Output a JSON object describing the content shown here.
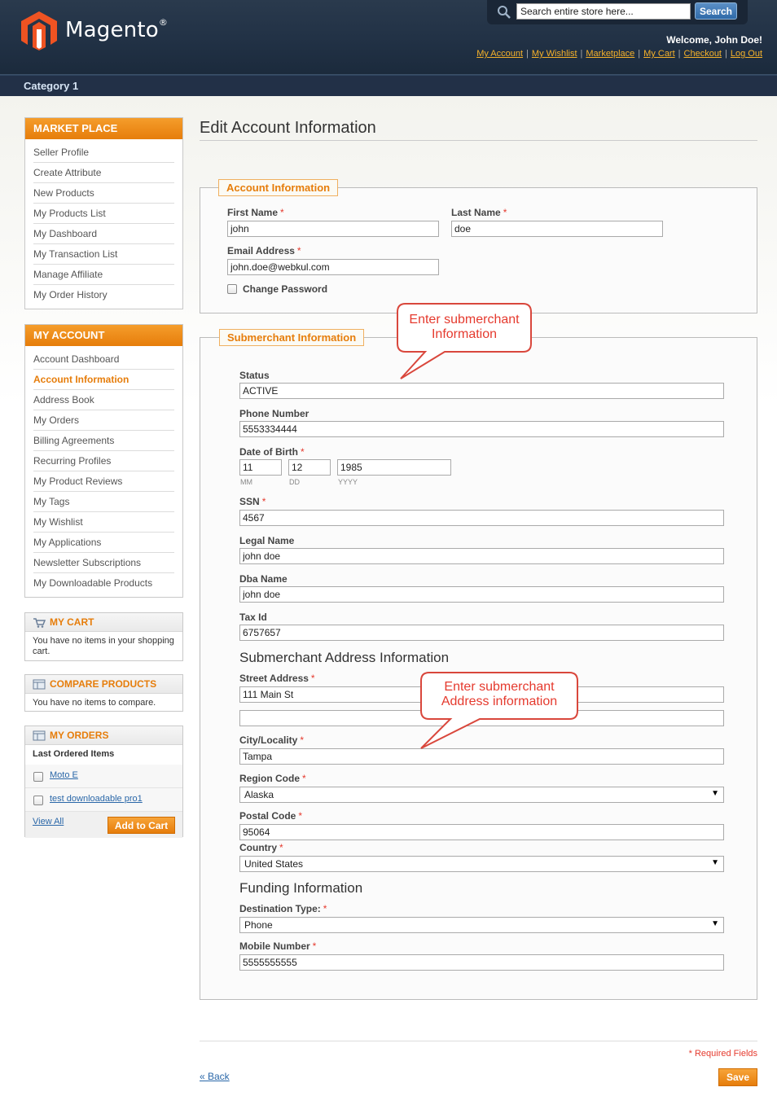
{
  "header": {
    "logo_text": "Magento",
    "logo_mark": "®",
    "search_placeholder": "Search entire store here...",
    "search_button": "Search",
    "welcome": "Welcome, John Doe!",
    "links": [
      "My Account",
      "My Wishlist",
      "Marketplace",
      "My Cart",
      "Checkout",
      "Log Out"
    ]
  },
  "nav": {
    "category": "Category 1"
  },
  "sidebar": {
    "marketplace": {
      "title": "MARKET PLACE",
      "items": [
        "Seller Profile",
        "Create Attribute",
        "New Products",
        "My Products List",
        "My Dashboard",
        "My Transaction List",
        "Manage Affiliate",
        "My Order History"
      ]
    },
    "my_account": {
      "title": "MY ACCOUNT",
      "active_index": 1,
      "items": [
        "Account Dashboard",
        "Account Information",
        "Address Book",
        "My Orders",
        "Billing Agreements",
        "Recurring Profiles",
        "My Product Reviews",
        "My Tags",
        "My Wishlist",
        "My Applications",
        "Newsletter Subscriptions",
        "My Downloadable Products"
      ]
    },
    "my_cart": {
      "title": "MY CART",
      "text": "You have no items in your shopping cart."
    },
    "compare": {
      "title": "COMPARE PRODUCTS",
      "text": "You have no items to compare."
    },
    "my_orders": {
      "title": "MY ORDERS",
      "subtitle": "Last Ordered Items",
      "items": [
        "Moto E",
        "test downloadable pro1"
      ],
      "view_all": "View All",
      "add_to_cart": "Add to Cart"
    }
  },
  "main": {
    "title": "Edit Account Information",
    "account_info": {
      "legend": "Account Information",
      "first_name_label": "First Name",
      "first_name": "john",
      "last_name_label": "Last Name",
      "last_name": "doe",
      "email_label": "Email Address",
      "email": "john.doe@webkul.com",
      "change_password": "Change Password"
    },
    "submerchant": {
      "legend": "Submerchant Information",
      "status_label": "Status",
      "status": "ACTIVE",
      "phone_label": "Phone Number",
      "phone": "5553334444",
      "dob_label": "Date of Birth",
      "dob_mm": "11",
      "dob_dd": "12",
      "dob_yyyy": "1985",
      "hint_mm": "MM",
      "hint_dd": "DD",
      "hint_yyyy": "YYYY",
      "ssn_label": "SSN",
      "ssn": "4567",
      "legal_name_label": "Legal Name",
      "legal_name": "john doe",
      "dba_label": "Dba Name",
      "dba": "john doe",
      "tax_label": "Tax Id",
      "tax": "6757657",
      "address_heading": "Submerchant Address Information",
      "street_label": "Street Address",
      "street1": "111 Main St",
      "street2": "",
      "city_label": "City/Locality",
      "city": "Tampa",
      "region_label": "Region Code",
      "region": "Alaska",
      "postal_label": "Postal Code",
      "postal": "95064",
      "country_label": "Country",
      "country": "United States",
      "funding_heading": "Funding Information",
      "destination_label": "Destination Type:",
      "destination": "Phone",
      "mobile_label": "Mobile Number",
      "mobile": "5555555555"
    },
    "callout1": [
      "Enter submerchant",
      "Information"
    ],
    "callout2": [
      "Enter submerchant",
      "Address information"
    ],
    "required_note": "* Required Fields",
    "back": "« Back",
    "save": "Save"
  },
  "colors": {
    "accent": "#e67d0b",
    "header": "#223246",
    "link": "#2a67a8",
    "callout": "#e53a2e"
  }
}
